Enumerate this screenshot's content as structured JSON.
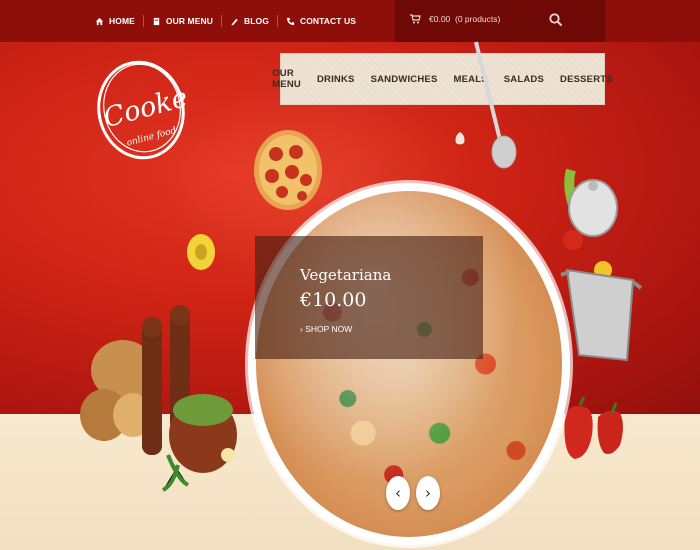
{
  "top_nav": {
    "items": [
      {
        "label": "HOME",
        "icon": "home-icon"
      },
      {
        "label": "OUR MENU",
        "icon": "book-icon"
      },
      {
        "label": "BLOG",
        "icon": "pencil-icon"
      },
      {
        "label": "CONTACT US",
        "icon": "phone-icon"
      }
    ]
  },
  "cart": {
    "label": "€0.00  (0 products)",
    "icon": "cart-icon"
  },
  "search": {
    "icon": "search-icon"
  },
  "logo": {
    "main": "Cooker",
    "sub": "online food"
  },
  "main_nav": {
    "items": [
      "OUR MENU",
      "DRINKS",
      "SANDWICHES",
      "MEALS",
      "SALADS",
      "DESSERTS"
    ]
  },
  "slide": {
    "title": "Vegetariana",
    "price": "€10.00",
    "cta": "› SHOP NOW"
  },
  "slider_controls": {
    "prev": "‹",
    "next": "›"
  },
  "colors": {
    "brand_red": "#c41f14",
    "dark_red": "#8e0f0a",
    "cream": "#f5e5c8"
  }
}
